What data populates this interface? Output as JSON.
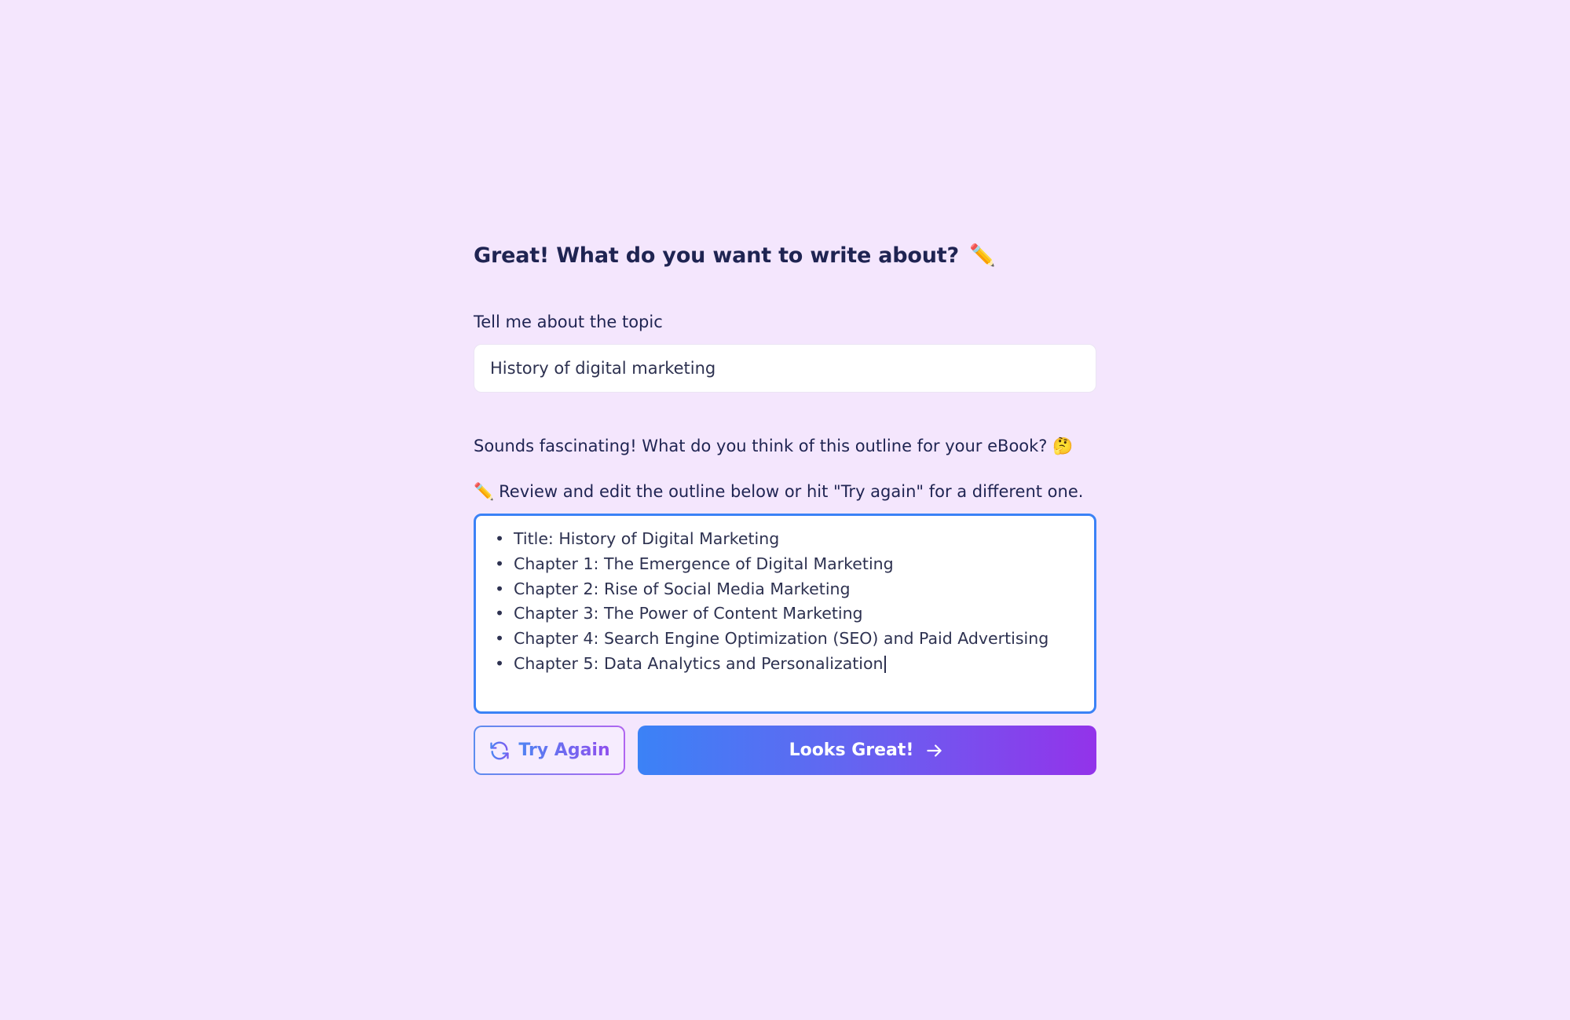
{
  "heading": {
    "title": "Great! What do you want to write about?",
    "emoji": "✏️"
  },
  "topic": {
    "label": "Tell me about the topic",
    "value": "History of digital marketing"
  },
  "response": {
    "message": "Sounds fascinating! What do you think of this outline for your eBook? 🤔",
    "instruction_icon": "✏️",
    "instruction": "Review and edit the outline below or hit \"Try again\" for a different one."
  },
  "outline": {
    "items": [
      "Title: History of Digital Marketing",
      "Chapter 1: The Emergence of Digital Marketing",
      "Chapter 2: Rise of Social Media Marketing",
      "Chapter 3: The Power of Content Marketing",
      "Chapter 4: Search Engine Optimization (SEO) and Paid Advertising",
      "Chapter 5: Data Analytics and Personalization"
    ]
  },
  "actions": {
    "try_again_label": "Try Again",
    "try_again_icon": "refresh-icon",
    "looks_great_label": "Looks Great!",
    "looks_great_icon": "arrow-right-icon"
  },
  "colors": {
    "background": "#f4e6fd",
    "text": "#1f2452",
    "focus_border": "#3b82f6",
    "gradient_start": "#3b82f6",
    "gradient_end": "#9333ea"
  }
}
